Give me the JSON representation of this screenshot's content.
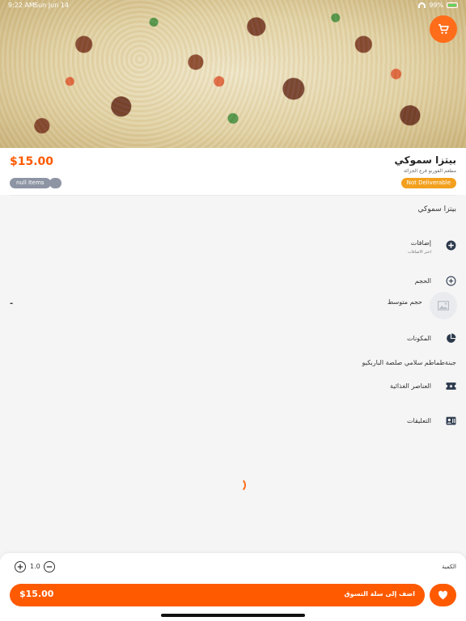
{
  "status_bar": {
    "time": "9:22 AM",
    "date": "Sun Jun 14",
    "battery": "99%"
  },
  "product": {
    "title": "بيتزا سموكي",
    "restaurant": "مطعم الفورنو فرع الجزائة",
    "price": "$15.00",
    "chip_items": "null Items",
    "delivery_badge": "Not Deliverable",
    "description": "بيتزا سموكي"
  },
  "sections": {
    "additions": {
      "title": "إضافات",
      "hint": "اختر الاضافات"
    },
    "size": {
      "title": "الحجم",
      "option_label": "حجم متوسط",
      "option_price": "-"
    },
    "ingredients": {
      "title": "المكونات",
      "value": "جبنةطماطم سلامي صلصة الباربكيو"
    },
    "nutrition": {
      "title": "العناصر الغذائية"
    },
    "comments": {
      "title": "التعليقات"
    }
  },
  "footer": {
    "quantity_label": "الكمية",
    "quantity_value": "1.0",
    "add_to_cart_label": "اضف إلى سلة التسوق",
    "total_price": "$15.00"
  },
  "icons": {
    "cart": "cart-icon",
    "add_circle": "plus-circle-icon",
    "pie": "pie-chart-icon",
    "ticket": "ticket-icon",
    "comments": "contact-card-icon",
    "heart": "heart-icon",
    "image_placeholder": "image-icon"
  },
  "colors": {
    "accent": "#ff5a00",
    "badge_orange": "#f3a01e",
    "chip_gray": "#8d94a3"
  }
}
